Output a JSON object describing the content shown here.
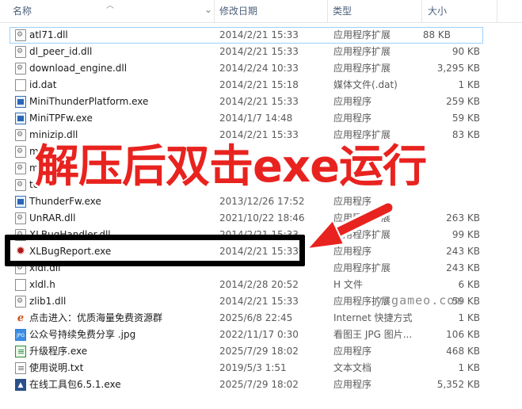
{
  "header": {
    "name": "名称",
    "date": "修改日期",
    "type": "类型",
    "size": "大小",
    "sort_icon": "chevron-up-icon"
  },
  "files": [
    {
      "name": "atl71.dll",
      "date": "2014/2/21 15:33",
      "type": "应用程序扩展",
      "size": "88 KB",
      "icon": "dll-file-icon"
    },
    {
      "name": "dl_peer_id.dll",
      "date": "2014/2/21 15:33",
      "type": "应用程序扩展",
      "size": "90 KB",
      "icon": "dll-file-icon"
    },
    {
      "name": "download_engine.dll",
      "date": "2014/2/24 10:33",
      "type": "应用程序扩展",
      "size": "3,295 KB",
      "icon": "dll-file-icon"
    },
    {
      "name": "id.dat",
      "date": "2014/2/21 15:18",
      "type": "媒体文件(.dat)",
      "size": "1 KB",
      "icon": "dat-file-icon"
    },
    {
      "name": "MiniThunderPlatform.exe",
      "date": "2014/2/21 15:33",
      "type": "应用程序",
      "size": "259 KB",
      "icon": "exe-file-icon"
    },
    {
      "name": "MiniTPFw.exe",
      "date": "2014/1/7 14:48",
      "type": "应用程序",
      "size": "59 KB",
      "icon": "exe-file-icon"
    },
    {
      "name": "minizip.dll",
      "date": "2014/2/21 15:33",
      "type": "应用程序扩展",
      "size": "83 KB",
      "icon": "dll-file-icon"
    },
    {
      "name": "mo",
      "date": "",
      "type": "",
      "size": "",
      "icon": "dll-file-icon"
    },
    {
      "name": "m",
      "date": "",
      "type": "",
      "size": "",
      "icon": "dll-file-icon"
    },
    {
      "name": "te",
      "date": "",
      "type": "",
      "size": "",
      "icon": "dll-file-icon"
    },
    {
      "name": "ThunderFw.exe",
      "date": "2013/12/26 17:52",
      "type": "应用程序",
      "size": "",
      "icon": "exe-file-icon"
    },
    {
      "name": "UnRAR.dll",
      "date": "2021/10/22 18:46",
      "type": "应用程序扩展",
      "size": "263 KB",
      "icon": "dll-file-icon"
    },
    {
      "name": "XLBugHandler.dll",
      "date": "2014/2/21 15:33",
      "type": "应用程序扩展",
      "size": "99 KB",
      "icon": "dll-file-icon"
    },
    {
      "name": "XLBugReport.exe",
      "date": "2014/2/21 15:33",
      "type": "应用程序",
      "size": "243 KB",
      "icon": "bug-icon"
    },
    {
      "name": "xldl.dll",
      "date": "",
      "type": "应用程序扩展",
      "size": "243 KB",
      "icon": "dll-file-icon"
    },
    {
      "name": "xldl.h",
      "date": "2014/2/28 20:52",
      "type": "H 文件",
      "size": "6 KB",
      "icon": "h-file-icon"
    },
    {
      "name": "zlib1.dll",
      "date": "2014/2/21 15:33",
      "type": "应用程序扩展",
      "size": "59 KB",
      "icon": "dll-file-icon"
    },
    {
      "name": "点击进入：优质海量免费资源群",
      "date": "2025/6/8 22:45",
      "type": "Internet 快捷方式",
      "size": "1 KB",
      "icon": "internet-shortcut-icon"
    },
    {
      "name": "公众号持续免费分享 .jpg",
      "date": "2022/11/17 0:30",
      "type": "看图王 JPG 图片...",
      "size": "106 KB",
      "icon": "jpg-file-icon"
    },
    {
      "name": "升级程序.exe",
      "date": "2025/7/29 18:02",
      "type": "应用程序",
      "size": "468 KB",
      "icon": "updater-exe-icon"
    },
    {
      "name": "使用说明.txt",
      "date": "2019/5/3 1:51",
      "type": "文本文档",
      "size": "1 KB",
      "icon": "txt-file-icon"
    },
    {
      "name": "在线工具包6.5.1.exe",
      "date": "2025/7/29 18:02",
      "type": "应用程序",
      "size": "5,352 KB",
      "icon": "toolkit-exe-icon"
    }
  ],
  "overlay": {
    "headline": "解压后双击exe运行",
    "watermark": "ysgameo.com",
    "headline_color": "#e8231f",
    "arrow_color": "#e8231f"
  }
}
